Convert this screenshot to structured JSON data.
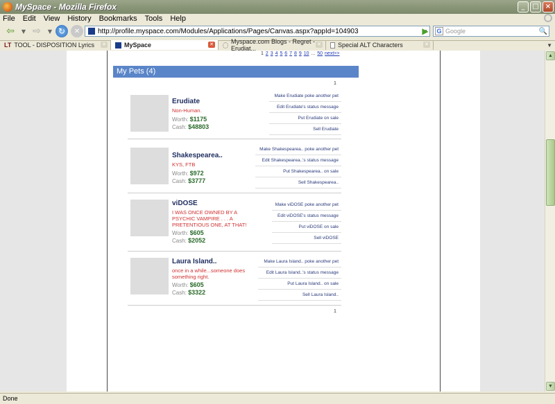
{
  "window": {
    "title": "MySpace - Mozilla Firefox"
  },
  "menu": [
    "File",
    "Edit",
    "View",
    "History",
    "Bookmarks",
    "Tools",
    "Help"
  ],
  "nav": {
    "url": "http://profile.myspace.com/Modules/Applications/Pages/Canvas.aspx?appId=104903",
    "search_placeholder": "Google"
  },
  "tabs": [
    {
      "label": "TOOL - DISPOSITION Lyrics",
      "prefix": "LT",
      "active": false
    },
    {
      "label": "MySpace",
      "active": true
    },
    {
      "label": "Myspace.com Blogs - Regret - Erudiat...",
      "active": false
    },
    {
      "label": "Special ALT Characters",
      "active": false
    }
  ],
  "page": {
    "pager_pages": [
      "1",
      "2",
      "3",
      "4",
      "5",
      "6",
      "7",
      "8",
      "9",
      "10",
      "...",
      "50",
      "next>>"
    ],
    "header": "My Pets (4)",
    "top_num": "1",
    "bottom_num": "1",
    "pets": [
      {
        "name": "Erudiate",
        "status": "Non-Human.",
        "worth_label": "Worth:",
        "worth": "$1175",
        "cash_label": "Cash:",
        "cash": "$48803",
        "actions": [
          "Make Erudiate poke another pet",
          "Edit Erudiate's status message",
          "Put Erudiate on sale",
          "Sell Erudiate"
        ]
      },
      {
        "name": "Shakespearea..",
        "status": "KYS, FTB",
        "worth_label": "Worth:",
        "worth": "$972",
        "cash_label": "Cash:",
        "cash": "$3777",
        "actions": [
          "Make Shakespearea.. poke another pet",
          "Edit Shakespearea..'s status message",
          "Put Shakespearea.. on sale",
          "Sell Shakespearea.."
        ]
      },
      {
        "name": "viDOSE",
        "status": "I WAS ONCE OWNED BY A PSYCHIC VAMPIRE . . . A PRETENTIOUS ONE, AT THAT!",
        "worth_label": "Worth:",
        "worth": "$605",
        "cash_label": "Cash:",
        "cash": "$2052",
        "actions": [
          "Make viDOSE poke another pet",
          "Edit viDOSE's status message",
          "Put viDOSE on sale",
          "Sell viDOSE"
        ]
      },
      {
        "name": "Laura Island..",
        "status": "once in a while...someone does something right.",
        "worth_label": "Worth:",
        "worth": "$605",
        "cash_label": "Cash:",
        "cash": "$3322",
        "actions": [
          "Make Laura Island.. poke another pet",
          "Edit Laura Island..'s status message",
          "Put Laura Island.. on sale",
          "Sell Laura Island.."
        ]
      }
    ]
  },
  "status_bar": "Done"
}
